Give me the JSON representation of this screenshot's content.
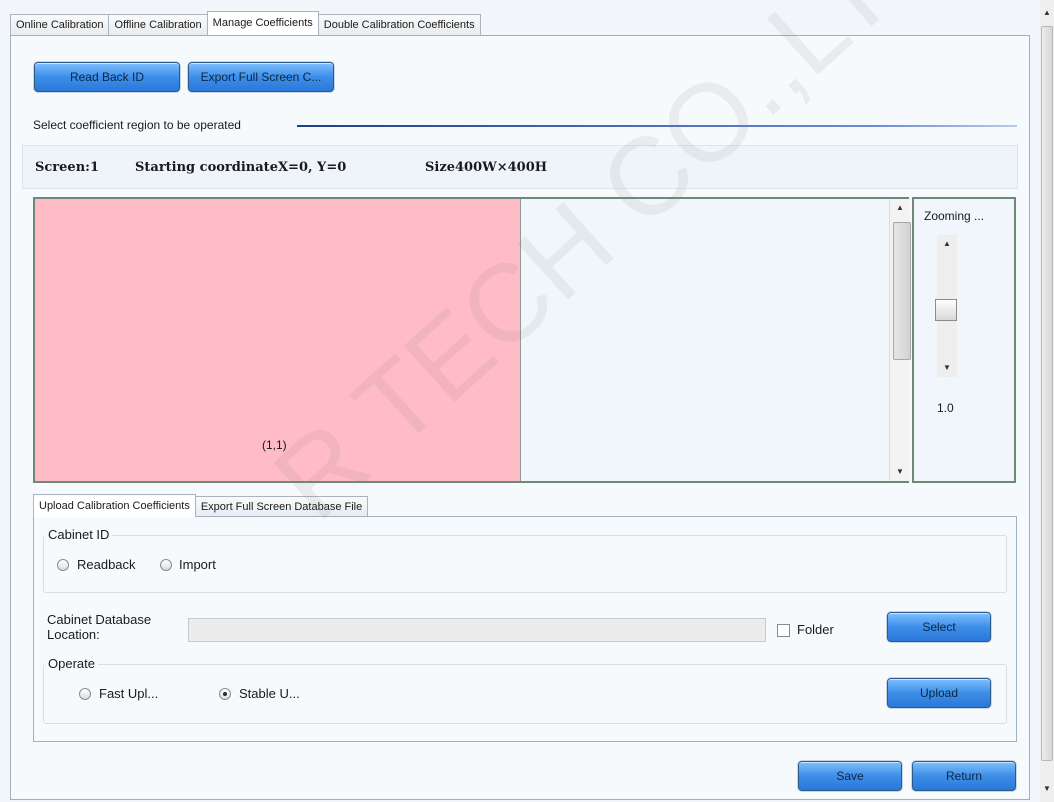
{
  "top_tabs": [
    "Online Calibration",
    "Offline Calibration",
    "Manage Coefficients",
    "Double Calibration Coefficients"
  ],
  "toolbar": {
    "read_back_id": "Read Back ID",
    "export_full_screen": "Export Full Screen C..."
  },
  "section": {
    "select_region": "Select coefficient region to be operated"
  },
  "info_bar": {
    "screen": "Screen:1",
    "coordinate": "Starting coordinateX=0, Y=0",
    "size": "Size400W×400H"
  },
  "canvas": {
    "region_label": "(1,1)",
    "region_color": "#ffbcc7"
  },
  "zoom": {
    "title": "Zooming ...",
    "value": "1.0",
    "level_fraction": 0.45
  },
  "bottom_tabs": [
    "Upload Calibration Coefficients",
    "Export Full Screen Database File"
  ],
  "upload": {
    "cabinet_id_title": "Cabinet ID",
    "readback": "Readback",
    "import": "Import",
    "db_location_label": "Cabinet Database Location:",
    "db_location_value": "",
    "folder_label": "Folder",
    "select_button": "Select",
    "operate_title": "Operate",
    "fast_upload": "Fast Upl...",
    "stable_upload": "Stable U...",
    "upload_button": "Upload"
  },
  "footer": {
    "save": "Save",
    "return": "Return"
  },
  "watermark": "R TECH CO.,LTD."
}
